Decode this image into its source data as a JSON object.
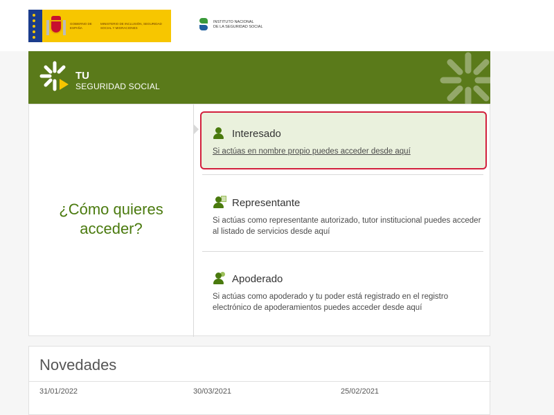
{
  "top": {
    "gov_logo": {
      "line1": "Gobierno de España",
      "line2": "Ministerio de Inclusión, Seguridad Social y Migraciones"
    },
    "inss_logo": {
      "line1": "Instituto Nacional",
      "line2": "de la Seguridad Social"
    }
  },
  "header": {
    "title_small": "TU",
    "title_big": "SEGURIDAD SOCIAL"
  },
  "access": {
    "question": "¿Cómo quieres acceder?",
    "options": [
      {
        "label": "Interesado",
        "desc": "Si actúas en nombre propio puedes acceder desde aquí",
        "icon": "person-icon"
      },
      {
        "label": "Representante",
        "desc": "Si actúas como representante autorizado, tutor institucional puedes acceder al listado de servicios desde aquí",
        "icon": "person-id-card-icon"
      },
      {
        "label": "Apoderado",
        "desc": "Si actúas como apoderado y tu poder está registrado en el registro electrónico de apoderamientos puedes acceder desde aquí",
        "icon": "person-pair-icon"
      }
    ]
  },
  "news": {
    "title": "Novedades",
    "dates": [
      "31/01/2022",
      "30/03/2021",
      "25/02/2021"
    ]
  },
  "colors": {
    "brand_green": "#5a7a1a",
    "highlight_bg": "#eaf1dd",
    "highlight_border": "#d21f3c",
    "gov_yellow": "#f7c600"
  }
}
